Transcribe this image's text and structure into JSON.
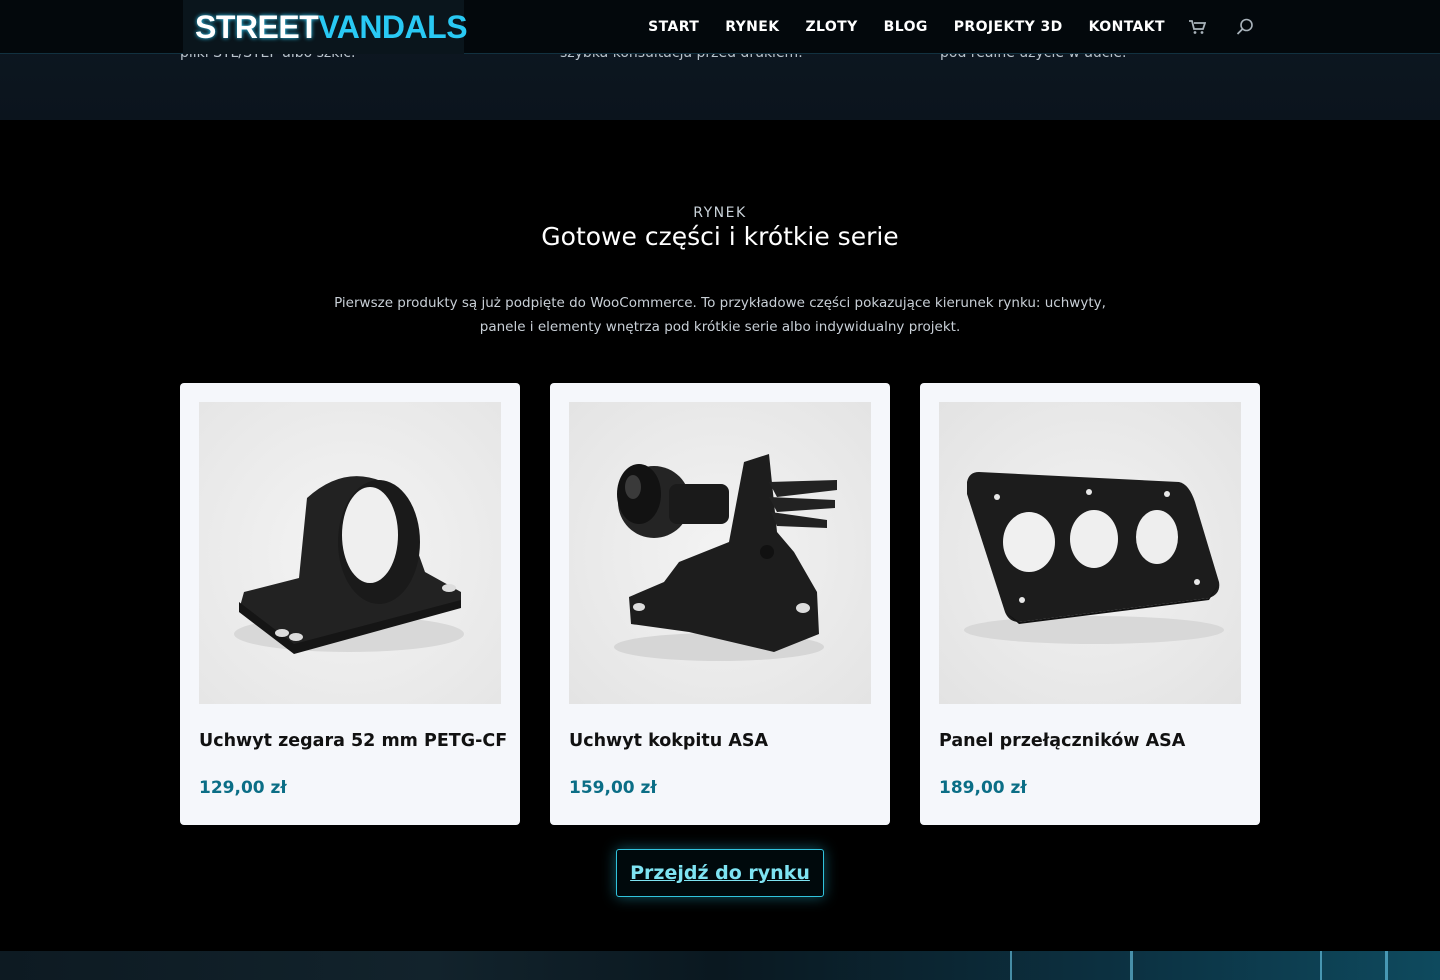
{
  "top_band": {
    "cut_texts": [
      "pliki STL/STEP albo szkic.",
      "szybka konsultacja przed drukiem.",
      "pod realne użycie w aucie."
    ]
  },
  "header": {
    "logo": {
      "part1": "STREET",
      "part2": "VANDALS"
    },
    "nav": [
      "START",
      "RYNEK",
      "ZLOTY",
      "BLOG",
      "PROJEKTY 3D",
      "KONTAKT"
    ],
    "icons": [
      "cart-icon",
      "search-icon"
    ]
  },
  "section": {
    "eyebrow": "RYNEK",
    "title": "Gotowe części i krótkie serie",
    "intro": "Pierwsze produkty są już podpięte do WooCommerce. To przykładowe części pokazujące kierunek rynku: uchwyty, panele i elementy wnętrza pod krótkie serie albo indywidualny projekt."
  },
  "products": [
    {
      "name": "Uchwyt zegara 52 mm PETG-CF",
      "price": "129,00 zł"
    },
    {
      "name": "Uchwyt kokpitu ASA",
      "price": "159,00 zł"
    },
    {
      "name": "Panel przełączników ASA",
      "price": "189,00 zł"
    }
  ],
  "cta": {
    "label": "Przejdź do rynku"
  },
  "colors": {
    "accent": "#29c9f4",
    "price": "#0b6e86",
    "background": "#000000"
  }
}
